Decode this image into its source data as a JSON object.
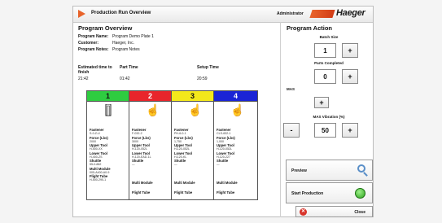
{
  "window": {
    "title": "Production Run Overview",
    "user": "Administrator",
    "logo": "Haeger"
  },
  "overview": {
    "heading": "Program Overview",
    "program_name_label": "Program Name:",
    "program_name": "Program Demo Plate 1",
    "customer_label": "Customer:",
    "customer": "Haeger, Inc.",
    "notes_label": "Program Notes:",
    "notes": "Program Notes",
    "estimated_label": "Estimated time to finish",
    "estimated_value": "21:42",
    "part_label": "Part Time",
    "part_value": "01:42",
    "setup_label": "Setup Time",
    "setup_value": "20:59"
  },
  "stations": [
    {
      "number": "1",
      "color": "#2ecc40",
      "icon": "tool-holder-icon",
      "details": [
        {
          "k": "Fastener",
          "v": "S-0-Z-U"
        },
        {
          "k": "Force (Lbs)",
          "v": "2000"
        },
        {
          "k": "Upper Tool",
          "v": "H-500-XX"
        },
        {
          "k": "Lower Tool",
          "v": "H-400-ZS"
        },
        {
          "k": "Shuttle",
          "v": "55-0-882"
        },
        {
          "k": "Multi Module",
          "v": "005-A400-A0-9"
        },
        {
          "k": "Flight Tube",
          "v": "H-500-290-1"
        }
      ]
    },
    {
      "number": "2",
      "color": "#e8252b",
      "icon": "hand-pointer-icon",
      "details": [
        {
          "k": "Fastener",
          "v": "F-032-2"
        },
        {
          "k": "Force (Lbs)",
          "v": "3000"
        },
        {
          "k": "Upper Tool",
          "v": "H-120-052L"
        },
        {
          "k": "Lower Tool",
          "v": "H-120-EAD-1L"
        },
        {
          "k": "Shuttle",
          "v": "—"
        }
      ],
      "extra": [
        "Multi Module",
        "Flight Tube"
      ]
    },
    {
      "number": "3",
      "color": "#f3e81b",
      "icon": "hand-pointer-icon",
      "details": [
        {
          "k": "Fastener",
          "v": "PH-6-0-1"
        },
        {
          "k": "Force (Lbs)",
          "v": "1,750"
        },
        {
          "k": "Upper Tool",
          "v": "H-120-052L"
        },
        {
          "k": "Lower Tool",
          "v": "H-120-KL"
        },
        {
          "k": "Shuttle",
          "v": "—"
        }
      ],
      "extra": [
        "Multi Module",
        "Flight Tube"
      ]
    },
    {
      "number": "4",
      "color": "#1a24d6",
      "icon": "hand-pointer-icon",
      "details": [
        {
          "k": "Fastener",
          "v": "CLS-632-1"
        },
        {
          "k": "Force (Lbs)",
          "v": "1,000"
        },
        {
          "k": "Upper Tool",
          "v": "H-120-052L"
        },
        {
          "k": "Lower Tool",
          "v": "H-120-227"
        },
        {
          "k": "Shuttle",
          "v": "—"
        }
      ],
      "extra": [
        "Multi Module",
        "Flight Tube"
      ]
    }
  ],
  "action": {
    "heading": "Program Action",
    "batch_label": "Batch Size",
    "batch_value": "1",
    "parts_label": "Parts Completed",
    "parts_value": "0",
    "mas_label": "MAS",
    "mas_btn": "+",
    "mas_vib_label": "MAS Vibration (%)",
    "mas_vib_value": "50",
    "plus": "+",
    "minus": "-",
    "preview_label": "Preview",
    "start_label": "Start Production",
    "close_label": "Close"
  }
}
